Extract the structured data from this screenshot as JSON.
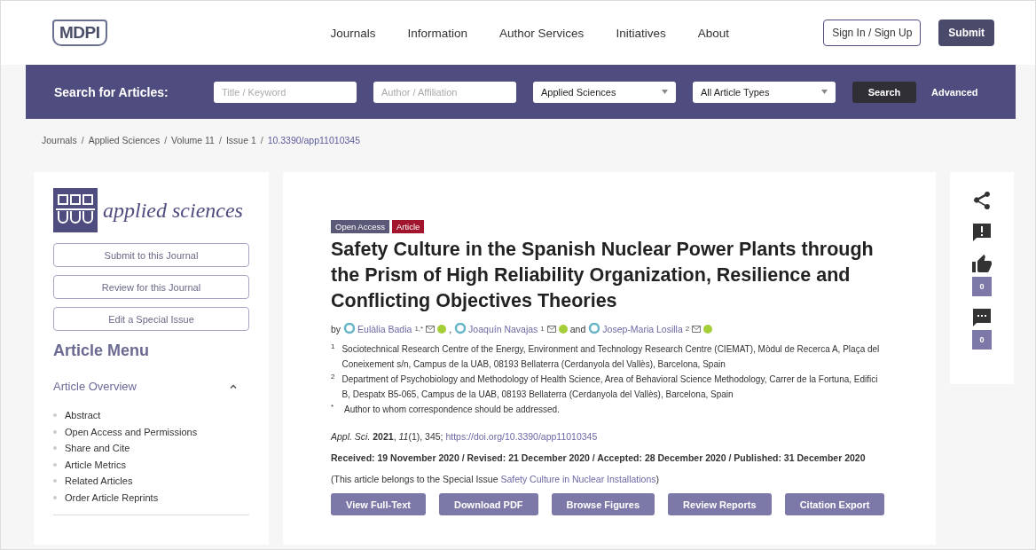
{
  "header": {
    "logo": "MDPI",
    "nav": [
      "Journals",
      "Information",
      "Author Services",
      "Initiatives",
      "About"
    ],
    "sign_in": "Sign In / Sign Up",
    "submit": "Submit"
  },
  "search": {
    "label": "Search for Articles:",
    "fields": [
      {
        "kind": "input",
        "placeholder": "Title / Keyword"
      },
      {
        "kind": "input",
        "placeholder": "Author / Affiliation"
      },
      {
        "kind": "select",
        "value": "Applied Sciences"
      },
      {
        "kind": "select",
        "value": "All Article Types"
      }
    ],
    "button": "Search",
    "advanced": "Advanced"
  },
  "breadcrumb_separator": "/",
  "breadcrumb": [
    {
      "label": "Journals",
      "current": false
    },
    {
      "label": "Applied Sciences",
      "current": false
    },
    {
      "label": "Volume 11",
      "current": false
    },
    {
      "label": "Issue 1",
      "current": false
    },
    {
      "label": "10.3390/app11010345",
      "current": true
    }
  ],
  "sidebar": {
    "journal": "applied sciences",
    "buttons": [
      "Submit to this Journal",
      "Review for this Journal",
      "Edit a Special Issue"
    ],
    "menu_title": "Article Menu",
    "section": {
      "title": "Article Overview",
      "expanded": true,
      "items": [
        "Abstract",
        "Open Access and Permissions",
        "Share and Cite",
        "Article Metrics",
        "Related Articles",
        "Order Article Reprints"
      ]
    }
  },
  "article": {
    "badges": [
      {
        "label": "Open Access",
        "color": "#5a5a78"
      },
      {
        "label": "Article",
        "color": "#a2162d"
      }
    ],
    "title": "Safety Culture in the Spanish Nuclear Power Plants through the Prism of High Reliability Organization, Resilience and Conflicting Objectives Theories",
    "by": "by",
    "and": "and",
    "comma": ",",
    "authors": [
      {
        "name": "Eulàlia Badia",
        "sup": "1,*"
      },
      {
        "name": "Joaquín Navajas",
        "sup": "1"
      },
      {
        "name": "Josep-Maria Losilla",
        "sup": "2"
      }
    ],
    "affiliations": [
      {
        "mark": "1",
        "text": "Sociotechnical Research Centre of the Energy, Environment and Technology Research Centre (CIEMAT), Mòdul de Recerca A, Plaça del Coneixement s/n, Campus de la UAB, 08193 Bellaterra (Cerdanyola del Vallès), Barcelona, Spain"
      },
      {
        "mark": "2",
        "text": "Department of Psychobiology and Methodology of Health Science, Area of Behavioral Science Methodology, Carrer de la Fortuna, Edifici B, Despatx B5-065, Campus de la UAB, 08193 Bellaterra (Cerdanyola del Vallès), Barcelona, Spain"
      },
      {
        "mark": "*",
        "text": "Author to whom correspondence should be addressed."
      }
    ],
    "citation": "*Appl. Sci.* **2021**, *11*(1), 345; ",
    "doi": "https://doi.org/10.3390/app11010345",
    "dates": "Received: 19 November 2020 / Revised: 21 December 2020 / Accepted: 28 December 2020 / Published: 31 December 2020",
    "special_prefix": "(This article belongs to the Special Issue ",
    "special_link": "Safety Culture in Nuclear Installations",
    "special_suffix": ")",
    "actions": [
      "View Full-Text",
      "Download PDF",
      "Browse Figures",
      "Review Reports",
      "Citation Export"
    ]
  },
  "side_tools": [
    {
      "kind": "share"
    },
    {
      "kind": "report"
    },
    {
      "kind": "like",
      "count": "0"
    },
    {
      "kind": "comment",
      "count": "0"
    }
  ]
}
